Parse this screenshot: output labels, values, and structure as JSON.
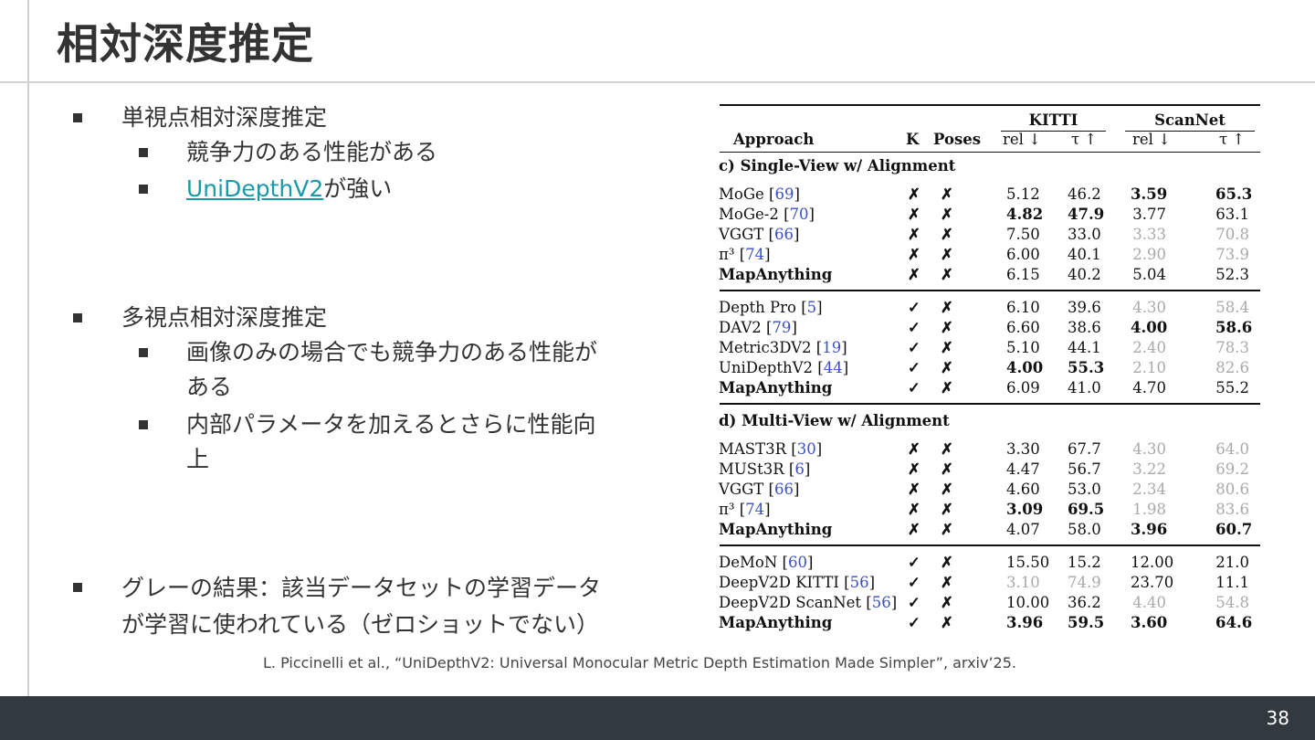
{
  "slide": {
    "title": "相対深度推定",
    "page_number": "38",
    "citation": "L. Piccinelli et al., “UniDepthV2: Universal Monocular Metric Depth Estimation Made Simpler”, arxiv’25."
  },
  "bullets": [
    {
      "text": "単視点相対深度推定",
      "sub": [
        {
          "text": "競争力のある性能がある"
        },
        {
          "link": "UniDepthV2",
          "text": "が強い"
        }
      ]
    },
    {
      "text": "多視点相対深度推定",
      "sub": [
        {
          "text": "画像のみの場合でも競争力のある性能が",
          "text2": "ある"
        },
        {
          "text": "内部パラメータを加えるとさらに性能向",
          "text2": "上"
        }
      ]
    },
    {
      "text": "グレーの結果：該当データセットの学習データ",
      "text2": "が学習に使われている（ゼロショットでない）"
    }
  ],
  "table": {
    "header_groups": [
      "KITTI",
      "ScanNet"
    ],
    "headers": [
      "Approach",
      "K",
      "Poses",
      "rel ↓",
      "τ ↑",
      "rel ↓",
      "τ ↑"
    ],
    "sections": [
      {
        "label": "c) Single-View w/ Alignment",
        "groups": [
          [
            {
              "name": "MoGe",
              "ref": "69",
              "k": "✗",
              "p": "✗",
              "kr": "5.12",
              "kt": "46.2",
              "sr": "3.59",
              "st": "65.3",
              "bold": [
                false,
                false,
                true,
                true
              ],
              "gray": [
                false,
                false,
                false,
                false
              ]
            },
            {
              "name": "MoGe-2",
              "ref": "70",
              "k": "✗",
              "p": "✗",
              "kr": "4.82",
              "kt": "47.9",
              "sr": "3.77",
              "st": "63.1",
              "bold": [
                true,
                true,
                false,
                false
              ],
              "gray": [
                false,
                false,
                false,
                false
              ]
            },
            {
              "name": "VGGT",
              "ref": "66",
              "k": "✗",
              "p": "✗",
              "kr": "7.50",
              "kt": "33.0",
              "sr": "3.33",
              "st": "70.8",
              "bold": [
                false,
                false,
                false,
                false
              ],
              "gray": [
                false,
                false,
                true,
                true
              ]
            },
            {
              "name": "π³",
              "ref": "74",
              "k": "✗",
              "p": "✗",
              "kr": "6.00",
              "kt": "40.1",
              "sr": "2.90",
              "st": "73.9",
              "bold": [
                false,
                false,
                false,
                false
              ],
              "gray": [
                false,
                false,
                true,
                true
              ]
            },
            {
              "name": "MapAnything",
              "ref": "",
              "name_bold": true,
              "k": "✗",
              "p": "✗",
              "kr": "6.15",
              "kt": "40.2",
              "sr": "5.04",
              "st": "52.3",
              "bold": [
                false,
                false,
                false,
                false
              ],
              "gray": [
                false,
                false,
                false,
                false
              ]
            }
          ],
          [
            {
              "name": "Depth Pro",
              "ref": "5",
              "k": "✓",
              "p": "✗",
              "kr": "6.10",
              "kt": "39.6",
              "sr": "4.30",
              "st": "58.4",
              "bold": [
                false,
                false,
                false,
                false
              ],
              "gray": [
                false,
                false,
                true,
                true
              ]
            },
            {
              "name": "DAV2",
              "ref": "79",
              "k": "✓",
              "p": "✗",
              "kr": "6.60",
              "kt": "38.6",
              "sr": "4.00",
              "st": "58.6",
              "bold": [
                false,
                false,
                true,
                true
              ],
              "gray": [
                false,
                false,
                false,
                false
              ]
            },
            {
              "name": "Metric3DV2",
              "ref": "19",
              "k": "✓",
              "p": "✗",
              "kr": "5.10",
              "kt": "44.1",
              "sr": "2.40",
              "st": "78.3",
              "bold": [
                false,
                false,
                false,
                false
              ],
              "gray": [
                false,
                false,
                true,
                true
              ]
            },
            {
              "name": "UniDepthV2",
              "ref": "44",
              "k": "✓",
              "p": "✗",
              "kr": "4.00",
              "kt": "55.3",
              "sr": "2.10",
              "st": "82.6",
              "bold": [
                true,
                true,
                false,
                false
              ],
              "gray": [
                false,
                false,
                true,
                true
              ]
            },
            {
              "name": "MapAnything",
              "ref": "",
              "name_bold": true,
              "k": "✓",
              "p": "✗",
              "kr": "6.09",
              "kt": "41.0",
              "sr": "4.70",
              "st": "55.2",
              "bold": [
                false,
                false,
                false,
                false
              ],
              "gray": [
                false,
                false,
                false,
                false
              ]
            }
          ]
        ]
      },
      {
        "label": "d) Multi-View w/ Alignment",
        "groups": [
          [
            {
              "name": "MAST3R",
              "ref": "30",
              "k": "✗",
              "p": "✗",
              "kr": "3.30",
              "kt": "67.7",
              "sr": "4.30",
              "st": "64.0",
              "bold": [
                false,
                false,
                false,
                false
              ],
              "gray": [
                false,
                false,
                true,
                true
              ]
            },
            {
              "name": "MUSt3R",
              "ref": "6",
              "k": "✗",
              "p": "✗",
              "kr": "4.47",
              "kt": "56.7",
              "sr": "3.22",
              "st": "69.2",
              "bold": [
                false,
                false,
                false,
                false
              ],
              "gray": [
                false,
                false,
                true,
                true
              ]
            },
            {
              "name": "VGGT",
              "ref": "66",
              "k": "✗",
              "p": "✗",
              "kr": "4.60",
              "kt": "53.0",
              "sr": "2.34",
              "st": "80.6",
              "bold": [
                false,
                false,
                false,
                false
              ],
              "gray": [
                false,
                false,
                true,
                true
              ]
            },
            {
              "name": "π³",
              "ref": "74",
              "k": "✗",
              "p": "✗",
              "kr": "3.09",
              "kt": "69.5",
              "sr": "1.98",
              "st": "83.6",
              "bold": [
                true,
                true,
                false,
                false
              ],
              "gray": [
                false,
                false,
                true,
                true
              ]
            },
            {
              "name": "MapAnything",
              "ref": "",
              "name_bold": true,
              "k": "✗",
              "p": "✗",
              "kr": "4.07",
              "kt": "58.0",
              "sr": "3.96",
              "st": "60.7",
              "bold": [
                false,
                false,
                true,
                true
              ],
              "gray": [
                false,
                false,
                false,
                false
              ]
            }
          ],
          [
            {
              "name": "DeMoN",
              "ref": "60",
              "k": "✓",
              "p": "✗",
              "kr": "15.50",
              "kt": "15.2",
              "sr": "12.00",
              "st": "21.0",
              "bold": [
                false,
                false,
                false,
                false
              ],
              "gray": [
                false,
                false,
                false,
                false
              ]
            },
            {
              "name": "DeepV2D KITTI",
              "ref": "56",
              "k": "✓",
              "p": "✗",
              "kr": "3.10",
              "kt": "74.9",
              "sr": "23.70",
              "st": "11.1",
              "bold": [
                false,
                false,
                false,
                false
              ],
              "gray": [
                true,
                true,
                false,
                false
              ]
            },
            {
              "name": "DeepV2D ScanNet",
              "ref": "56",
              "k": "✓",
              "p": "✗",
              "kr": "10.00",
              "kt": "36.2",
              "sr": "4.40",
              "st": "54.8",
              "bold": [
                false,
                false,
                false,
                false
              ],
              "gray": [
                false,
                false,
                true,
                true
              ]
            },
            {
              "name": "MapAnything",
              "ref": "",
              "name_bold": true,
              "k": "✓",
              "p": "✗",
              "kr": "3.96",
              "kt": "59.5",
              "sr": "3.60",
              "st": "64.6",
              "bold": [
                true,
                true,
                true,
                true
              ],
              "gray": [
                false,
                false,
                false,
                false
              ]
            }
          ]
        ]
      }
    ]
  }
}
